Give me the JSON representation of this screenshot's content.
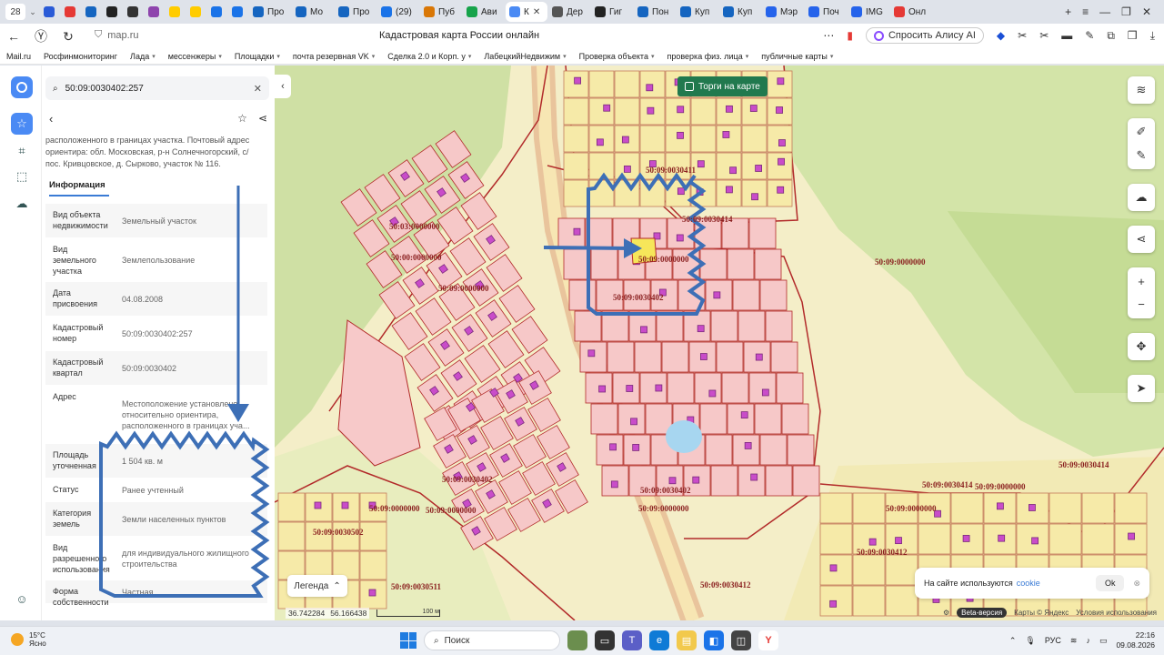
{
  "browser": {
    "tab_count": "28",
    "tabs": [
      {
        "label": "",
        "color": "#2a5bd7"
      },
      {
        "label": "",
        "color": "#e53935"
      },
      {
        "label": "",
        "color": "#1565c0"
      },
      {
        "label": "",
        "color": "#222"
      },
      {
        "label": "",
        "color": "#333"
      },
      {
        "label": "",
        "color": "#8e44ad"
      },
      {
        "label": "",
        "color": "#ffcc00"
      },
      {
        "label": "",
        "color": "#ffcc00"
      },
      {
        "label": "",
        "color": "#1a73e8"
      },
      {
        "label": "",
        "color": "#1a73e8"
      },
      {
        "label": "Про",
        "color": "#1565c0"
      },
      {
        "label": "Мо",
        "color": "#1565c0"
      },
      {
        "label": "Про",
        "color": "#1565c0"
      },
      {
        "label": "(29)",
        "color": "#1a73e8"
      },
      {
        "label": "Пуб",
        "color": "#d97706"
      },
      {
        "label": "Ави",
        "color": "#16a34a"
      },
      {
        "label": "К",
        "color": "#4a8af4",
        "active": true
      },
      {
        "label": "Дер",
        "color": "#555"
      },
      {
        "label": "Гиг",
        "color": "#222"
      },
      {
        "label": "Пон",
        "color": "#1565c0"
      },
      {
        "label": "Куп",
        "color": "#1565c0"
      },
      {
        "label": "Куп",
        "color": "#1565c0"
      },
      {
        "label": "Мэр",
        "color": "#2563eb"
      },
      {
        "label": "Поч",
        "color": "#2563eb"
      },
      {
        "label": "IMG",
        "color": "#2563eb"
      },
      {
        "label": "Онл",
        "color": "#e53935"
      }
    ],
    "url": "map.ru",
    "page_title": "Кадастровая карта России онлайн",
    "alice_label": "Спросить Алису AI",
    "bookmarks": [
      {
        "label": "Mail.ru",
        "caret": false
      },
      {
        "label": "Росфинмониторинг",
        "caret": false
      },
      {
        "label": "Лада",
        "caret": true
      },
      {
        "label": "мессенжеры",
        "caret": true
      },
      {
        "label": "Площадки",
        "caret": true
      },
      {
        "label": "почта резервная VK",
        "caret": true
      },
      {
        "label": "Сделка 2.0 и Корп. у",
        "caret": true
      },
      {
        "label": "ЛабецкийНедвижим",
        "caret": true
      },
      {
        "label": "Проверка объекта",
        "caret": true
      },
      {
        "label": "проверка физ. лица",
        "caret": true
      },
      {
        "label": "публичные карты",
        "caret": true
      }
    ]
  },
  "panel": {
    "search_value": "50:09:0030402:257",
    "address_snippet": "расположенного в границах участка. Почтовый адрес ориентира: обл. Московская, р-н Солнечногорский, с/пос. Кривцовское, д. Сырково, участок № 116.",
    "tab_label": "Информация",
    "rows": [
      {
        "k": "Вид объекта недвижимости",
        "v": "Земельный участок"
      },
      {
        "k": "Вид земельного участка",
        "v": "Землепользование"
      },
      {
        "k": "Дата присвоения",
        "v": "04.08.2008"
      },
      {
        "k": "Кадастровый номер",
        "v": "50:09:0030402:257"
      },
      {
        "k": "Кадастровый квартал",
        "v": "50:09:0030402"
      },
      {
        "k": "Адрес",
        "v": "Местоположение установлено относительно ориентира, расположенного в границах уча..."
      },
      {
        "k": "Площадь уточненная",
        "v": "1 504 кв. м"
      },
      {
        "k": "Статус",
        "v": "Ранее учтенный"
      },
      {
        "k": "Категория земель",
        "v": "Земли населенных пунктов"
      },
      {
        "k": "Вид разрешенного использования",
        "v": "для индивидуального жилищного строительства"
      },
      {
        "k": "Форма собственности",
        "v": "Частная"
      }
    ]
  },
  "map": {
    "torgi_label": "Торги на карте",
    "legend_label": "Легенда",
    "coord_lon": "36.742284",
    "coord_lat": "56.166438",
    "scale_label": "100 м",
    "beta_label": "Beta-версия",
    "attribution": "Карты © Яндекс",
    "terms": "Условия использования",
    "cookie_text": "На сайте используются",
    "cookie_link": "cookie",
    "cookie_ok": "Ok",
    "parcel_labels": [
      "50:09:0030411",
      "50:09:0030414",
      "50:03:0000000",
      "50:00:0000000",
      "50:09:0000000",
      "50:09:0000000",
      "50:09:0030402",
      "50:09:0000000",
      "50:09:0030402",
      "50:09:0000000",
      "50:09:0030402",
      "50:09:0000000",
      "50:09:0030502",
      "50:09:0030511",
      "50:09:0030412",
      "50:09:0030412",
      "50:09:0030414",
      "50:09:0000000",
      "50:09:0030414",
      "50:09:0000000",
      "50:09:0000000"
    ]
  },
  "taskbar": {
    "temp": "15°C",
    "weather": "Ясно",
    "search_label": "Поиск",
    "lang": "РУС",
    "time": "22:16",
    "date": "09.08.2026"
  }
}
